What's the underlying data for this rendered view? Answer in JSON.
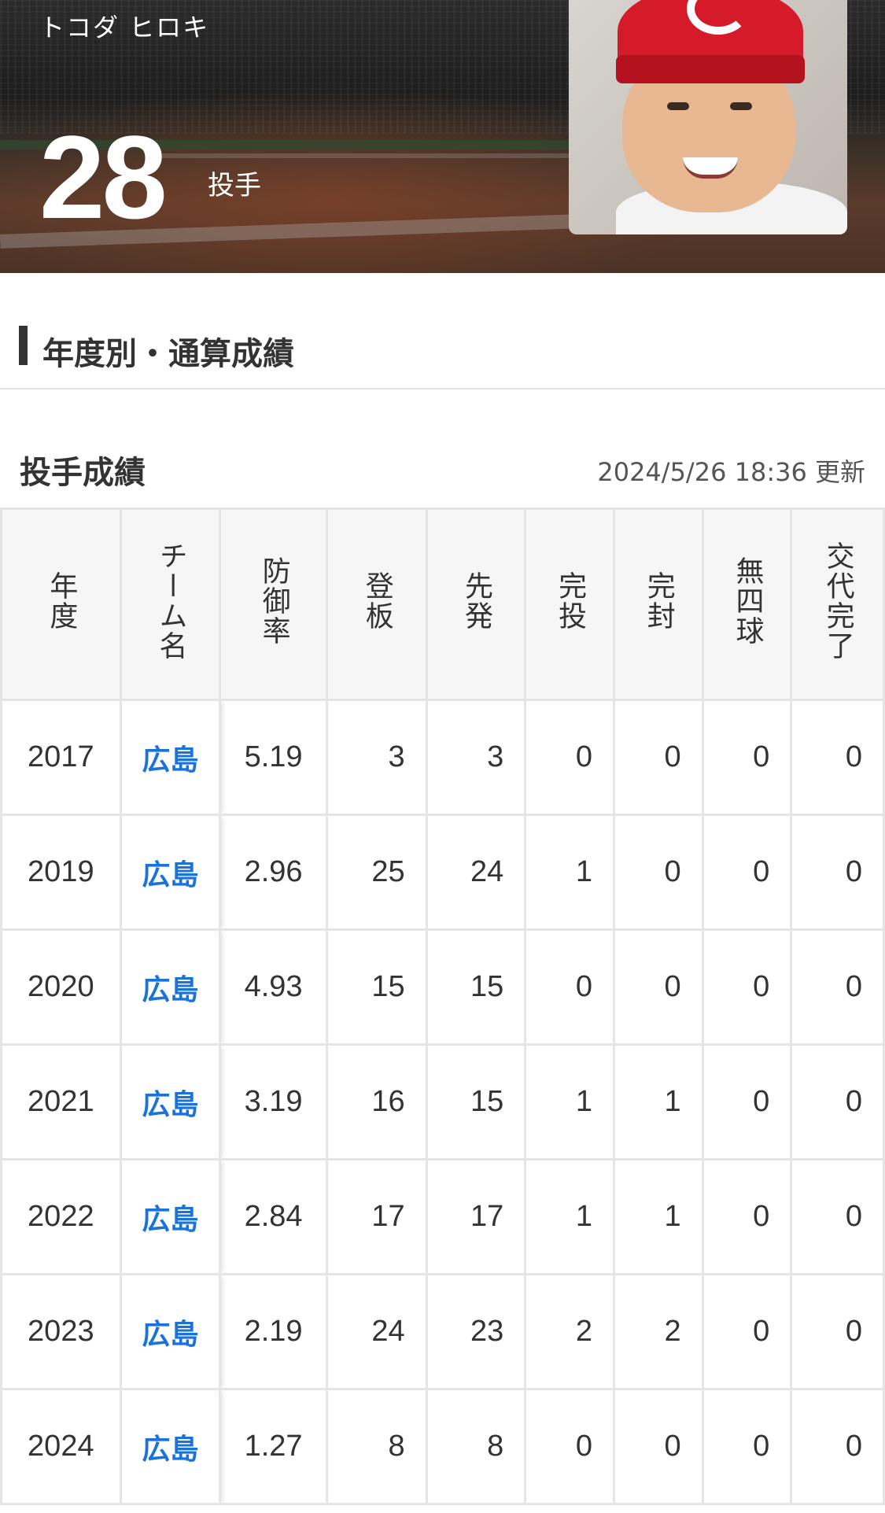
{
  "header": {
    "kana_name": "トコダ ヒロキ",
    "uniform_number": "28",
    "position": "投手"
  },
  "section": {
    "title": "年度別・通算成績"
  },
  "pitching": {
    "title": "投手成績",
    "updated": "2024/5/26 18:36 更新",
    "columns": [
      "年度",
      "チーム名",
      "防御率",
      "登板",
      "先発",
      "完投",
      "完封",
      "無四球",
      "交代完了"
    ],
    "rows": [
      {
        "year": "2017",
        "team": "広島",
        "era": "5.19",
        "games": "3",
        "starts": "3",
        "cg": "0",
        "sho": "0",
        "nobb": "0",
        "gf": "0"
      },
      {
        "year": "2019",
        "team": "広島",
        "era": "2.96",
        "games": "25",
        "starts": "24",
        "cg": "1",
        "sho": "0",
        "nobb": "0",
        "gf": "0"
      },
      {
        "year": "2020",
        "team": "広島",
        "era": "4.93",
        "games": "15",
        "starts": "15",
        "cg": "0",
        "sho": "0",
        "nobb": "0",
        "gf": "0"
      },
      {
        "year": "2021",
        "team": "広島",
        "era": "3.19",
        "games": "16",
        "starts": "15",
        "cg": "1",
        "sho": "1",
        "nobb": "0",
        "gf": "0"
      },
      {
        "year": "2022",
        "team": "広島",
        "era": "2.84",
        "games": "17",
        "starts": "17",
        "cg": "1",
        "sho": "1",
        "nobb": "0",
        "gf": "0"
      },
      {
        "year": "2023",
        "team": "広島",
        "era": "2.19",
        "games": "24",
        "starts": "23",
        "cg": "2",
        "sho": "2",
        "nobb": "0",
        "gf": "0"
      },
      {
        "year": "2024",
        "team": "広島",
        "era": "1.27",
        "games": "8",
        "starts": "8",
        "cg": "0",
        "sho": "0",
        "nobb": "0",
        "gf": "0"
      }
    ]
  },
  "colors": {
    "team_link": "#1a73d9"
  }
}
